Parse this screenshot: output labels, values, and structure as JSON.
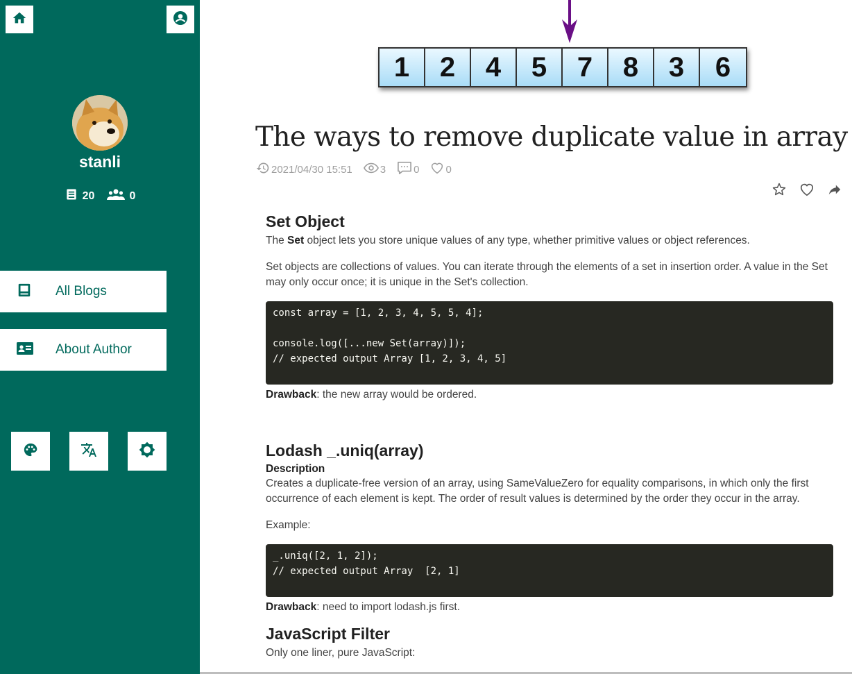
{
  "sidebar": {
    "username": "stanli",
    "blog_count": "20",
    "follower_count": "0",
    "nav": [
      {
        "label": "All Blogs",
        "icon": "book-icon"
      },
      {
        "label": "About Author",
        "icon": "id-card-icon"
      }
    ],
    "tools": [
      "palette-icon",
      "translate-icon",
      "brightness-icon"
    ]
  },
  "banner": {
    "array_values": [
      "1",
      "2",
      "4",
      "5",
      "7",
      "8",
      "3",
      "6"
    ]
  },
  "post": {
    "title": "The ways to remove duplicate value in array",
    "date": "2021/04/30 15:51",
    "views": "3",
    "comments": "0",
    "likes": "0"
  },
  "sections": {
    "s1": {
      "heading": "Set Object",
      "p1_pre": "The ",
      "p1_bold": "Set",
      "p1_post": " object lets you store unique values of any type, whether primitive values or object references.",
      "p2": "Set objects are collections of values. You can iterate through the elements of a set in insertion order. A value in the Set may only occur once; it is unique in the Set's collection.",
      "code": "const array = [1, 2, 3, 4, 5, 5, 4];\n\nconsole.log([...new Set(array)]);\n// expected output Array [1, 2, 3, 4, 5]",
      "drawback_label": "Drawback",
      "drawback_text": ": the new array would be ordered."
    },
    "s2": {
      "heading": "Lodash _.uniq(array)",
      "subheading": "Description",
      "p1": "Creates a duplicate-free version of an array, using SameValueZero for equality comparisons, in which only the first occurrence of each element is kept. The order of result values is determined by the order they occur in the array.",
      "p2": "Example:",
      "code": "_.uniq([2, 1, 2]);\n// expected output Array  [2, 1]",
      "drawback_label": "Drawback",
      "drawback_text": ": need to import lodash.js first."
    },
    "s3": {
      "heading": "JavaScript Filter",
      "p1": "Only one liner, pure JavaScript:"
    }
  },
  "colors": {
    "sidebar_bg": "#00695c",
    "code_bg": "#272822",
    "arrow": "#6a0f86"
  }
}
